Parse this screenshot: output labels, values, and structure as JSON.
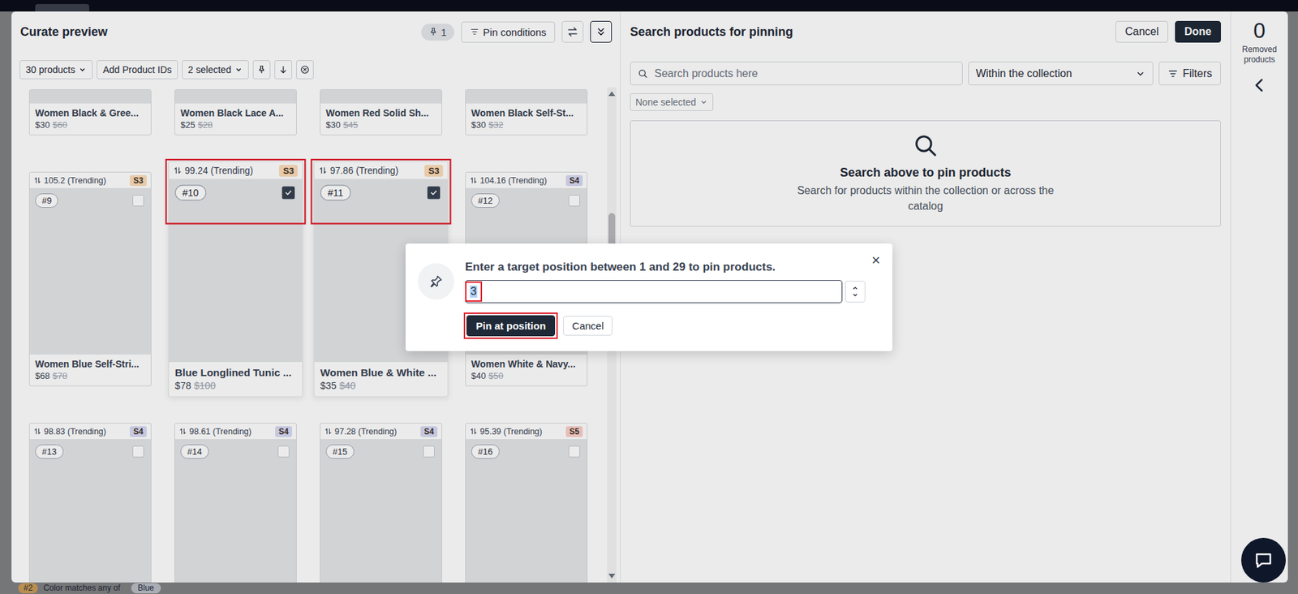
{
  "curate": {
    "title": "Curate preview",
    "pin_count": "1",
    "pin_conditions": "Pin conditions"
  },
  "toolbar": {
    "products": "30 products",
    "add_ids": "Add Product IDs",
    "selection": "2 selected"
  },
  "grid_scroll": {
    "level": 0.27
  },
  "products": [
    {
      "kind": "partial",
      "name": "Women Black & Gree...",
      "price": "$30",
      "original_price": "$60"
    },
    {
      "kind": "partial",
      "name": "Women Black Lace A...",
      "price": "$25",
      "original_price": "$28"
    },
    {
      "kind": "partial",
      "name": "Women Red Solid Sh...",
      "price": "$30",
      "original_price": "$45"
    },
    {
      "kind": "partial",
      "name": "Women Black Self-St...",
      "price": "$30",
      "original_price": "$32"
    },
    {
      "kind": "full",
      "position": "#9",
      "score": "105.2 (Trending)",
      "segment": "S3",
      "color": "#fcdcb8",
      "checked": false,
      "annotated": false,
      "name": "Women Blue Self-Stri...",
      "price": "$68",
      "original_price": "$78"
    },
    {
      "kind": "full",
      "position": "#10",
      "score": "99.24 (Trending)",
      "segment": "S3",
      "color": "#fcdcb8",
      "checked": true,
      "annotated": true,
      "name": "Blue Longlined Tunic ...",
      "price": "$78",
      "original_price": "$100"
    },
    {
      "kind": "full",
      "position": "#11",
      "score": "97.86 (Trending)",
      "segment": "S3",
      "color": "#fcdcb8",
      "checked": true,
      "annotated": true,
      "name": "Women Blue & White ...",
      "price": "$35",
      "original_price": "$40"
    },
    {
      "kind": "full",
      "position": "#12",
      "score": "104.16 (Trending)",
      "segment": "S4",
      "color": "#d7d9f3",
      "checked": false,
      "annotated": false,
      "name": "Women White & Navy...",
      "price": "$40",
      "original_price": "$50"
    },
    {
      "kind": "cut",
      "position": "#13",
      "score": "98.83 (Trending)",
      "segment": "S4",
      "color": "#d7d9f3",
      "checked": false,
      "annotated": false
    },
    {
      "kind": "cut",
      "position": "#14",
      "score": "98.61 (Trending)",
      "segment": "S4",
      "color": "#d7d9f3",
      "checked": false,
      "annotated": false
    },
    {
      "kind": "cut",
      "position": "#15",
      "score": "97.28 (Trending)",
      "segment": "S4",
      "color": "#d7d9f3",
      "checked": false,
      "annotated": false
    },
    {
      "kind": "cut",
      "position": "#16",
      "score": "95.39 (Trending)",
      "segment": "S5",
      "color": "#fbcfc9",
      "checked": false,
      "annotated": false
    }
  ],
  "search_panel": {
    "title": "Search products for pinning",
    "cancel": "Cancel",
    "done": "Done",
    "placeholder": "Search products here",
    "scope": "Within the collection",
    "filters": "Filters",
    "selection": "None selected",
    "empty_title": "Search above to pin products",
    "empty_text": "Search for products within the collection or across the catalog"
  },
  "removed": {
    "count": "0",
    "label": "Removed products"
  },
  "dialog": {
    "message": "Enter a target position between 1 and 29 to pin products.",
    "close": "×",
    "value": "3",
    "value_selected": true,
    "value_annotated": true,
    "confirm": {
      "label": "Pin at position",
      "annotated": true
    },
    "cancel": "Cancel"
  },
  "background_hint": {
    "badge": "#2",
    "text": "Color matches any of",
    "value": "Blue"
  }
}
